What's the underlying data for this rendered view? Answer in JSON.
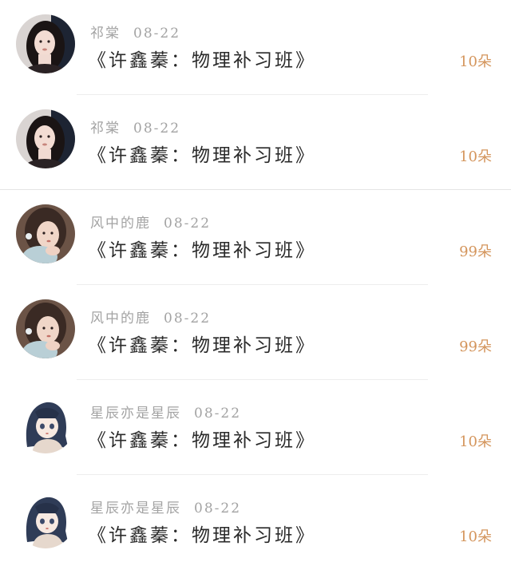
{
  "accent_color": "#d4955c",
  "comments": [
    {
      "user": "祁棠",
      "date": "08-22",
      "title": "《许鑫蓁：物理补习班》",
      "amount": "10朵",
      "avatar": "avatar-dark-hair-girl-icon"
    },
    {
      "user": "祁棠",
      "date": "08-22",
      "title": "《许鑫蓁：物理补习班》",
      "amount": "10朵",
      "avatar": "avatar-dark-hair-girl-icon"
    },
    {
      "user": "风中的鹿",
      "date": "08-22",
      "title": "《许鑫蓁：物理补习班》",
      "amount": "99朵",
      "avatar": "avatar-illustrated-girl-icon"
    },
    {
      "user": "风中的鹿",
      "date": "08-22",
      "title": "《许鑫蓁：物理补习班》",
      "amount": "99朵",
      "avatar": "avatar-illustrated-girl-icon"
    },
    {
      "user": "星辰亦是星辰",
      "date": "08-22",
      "title": "《许鑫蓁：物理补习班》",
      "amount": "10朵",
      "avatar": "avatar-anime-girl-icon"
    },
    {
      "user": "星辰亦是星辰",
      "date": "08-22",
      "title": "《许鑫蓁：物理补习班》",
      "amount": "10朵",
      "avatar": "avatar-anime-girl-icon"
    }
  ]
}
